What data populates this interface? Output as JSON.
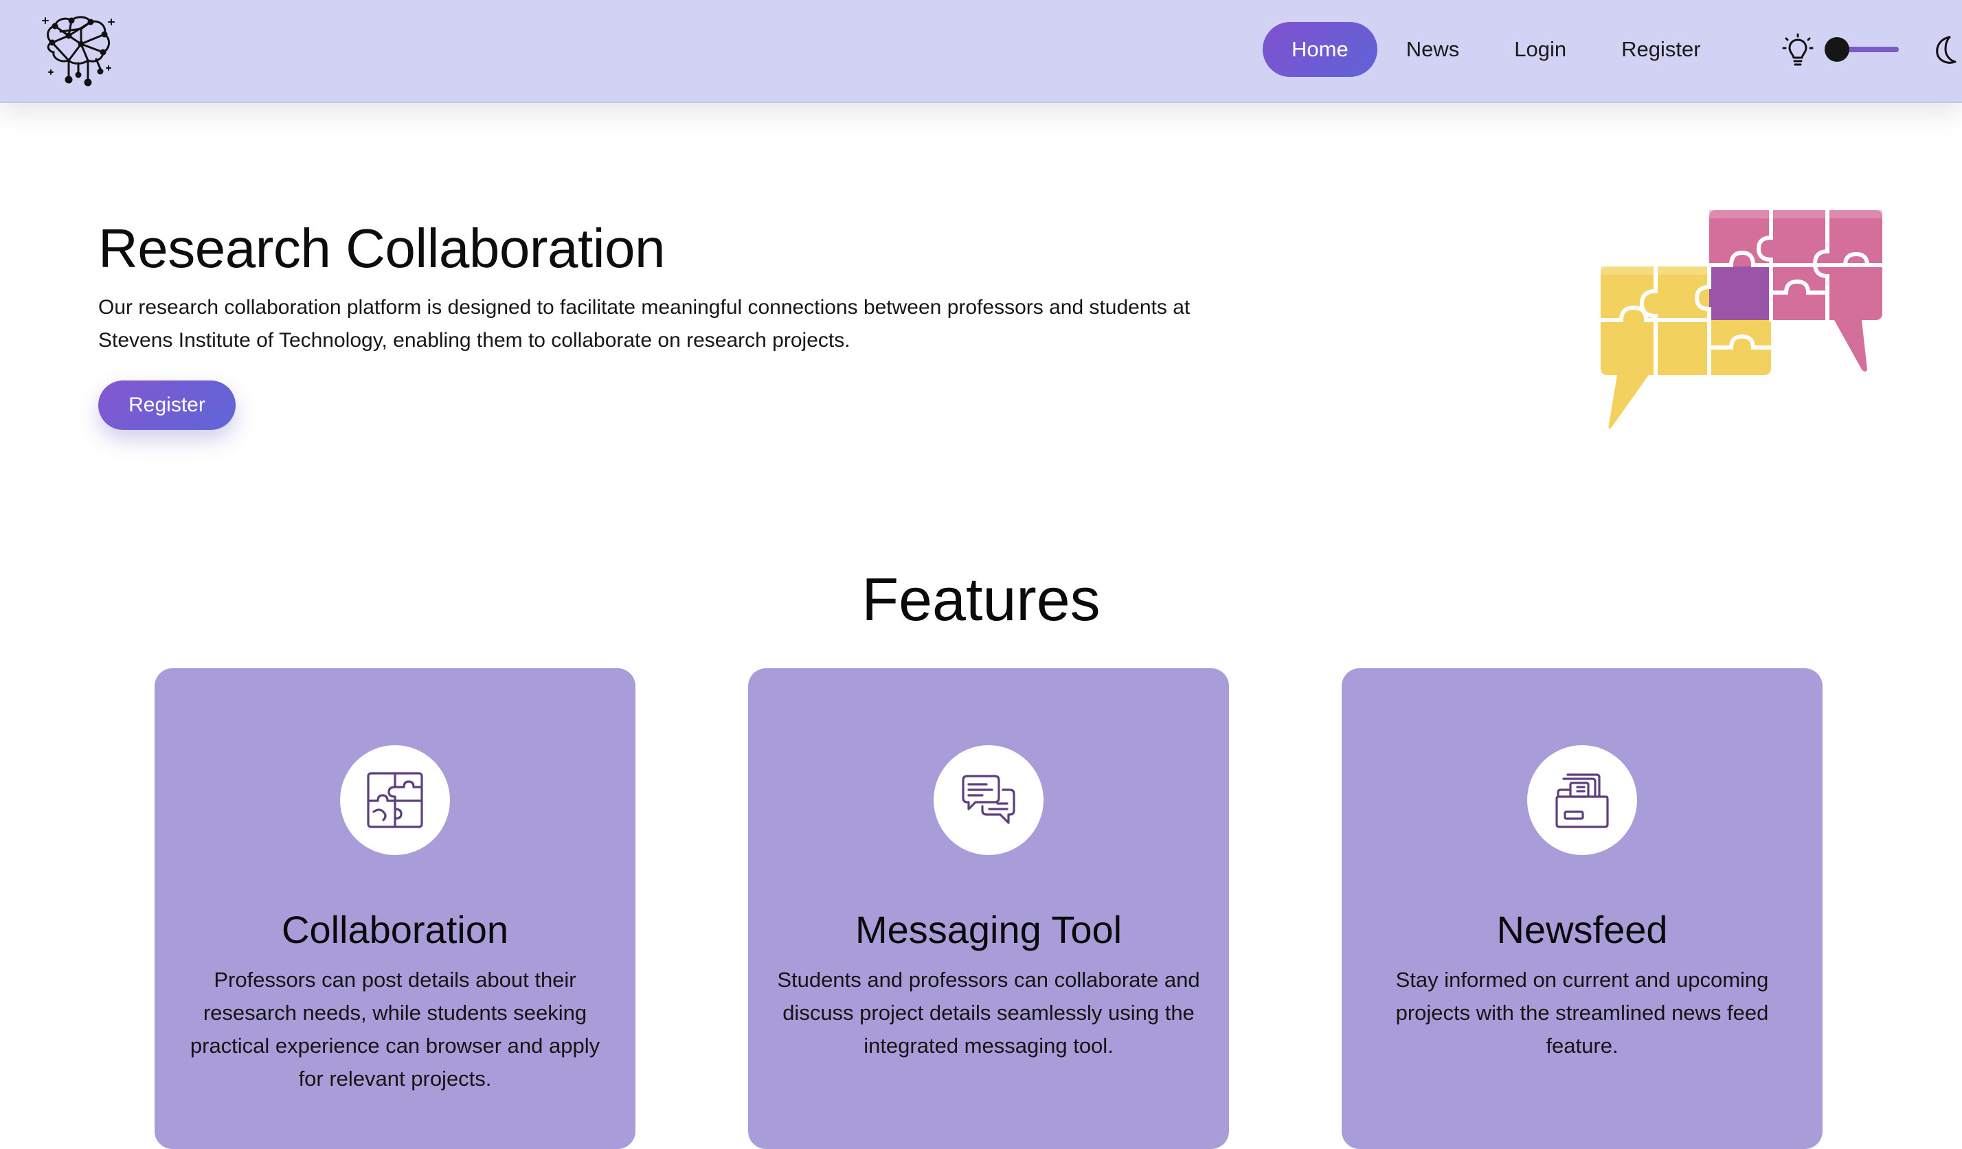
{
  "nav": {
    "logo_icon": "brain-network-logo",
    "links": [
      {
        "label": "Home",
        "active": true
      },
      {
        "label": "News",
        "active": false
      },
      {
        "label": "Login",
        "active": false
      },
      {
        "label": "Register",
        "active": false
      }
    ],
    "theme_toggle": {
      "mode": "light",
      "left_icon": "lightbulb-icon",
      "right_icon": "moon-icon"
    }
  },
  "hero": {
    "title": "Research Collaboration",
    "description": "Our research collaboration platform is designed to facilitate meaningful connections between professors and students at Stevens Institute of Technology, enabling them to collaborate on research projects.",
    "button_label": "Register",
    "illustration": "puzzle-speech-bubbles"
  },
  "features": {
    "title": "Features",
    "cards": [
      {
        "icon": "puzzle-icon",
        "title": "Collaboration",
        "text": "Professors can post details about their resesarch needs, while students seeking practical experience can browser and apply for relevant projects."
      },
      {
        "icon": "chat-bubbles-icon",
        "title": "Messaging Tool",
        "text": "Students and professors can collaborate and discuss project details seamlessly using the integrated messaging tool."
      },
      {
        "icon": "newsfeed-icon",
        "title": "Newsfeed",
        "text": "Stay informed on current and upcoming projects with the streamlined news feed feature."
      }
    ]
  },
  "colors": {
    "navbar_bg": "#d2d2f4",
    "accent_gradient_start": "#8052cf",
    "accent_gradient_end": "#5f63d6",
    "card_bg": "#a89dd8",
    "icon_stroke": "#5e3f7e"
  }
}
